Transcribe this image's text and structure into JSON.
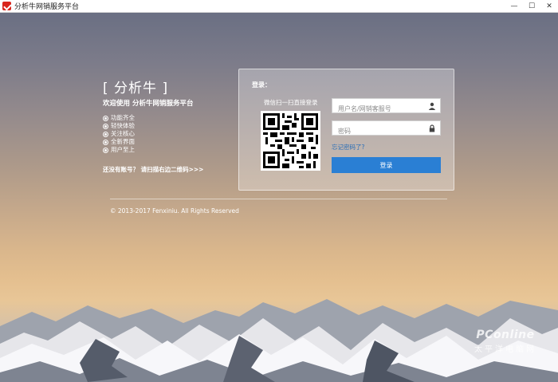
{
  "window": {
    "title": "分析牛网销服务平台",
    "minimize": "—",
    "maximize": "☐",
    "close": "✕"
  },
  "intro": {
    "brand": "[ 分析牛 ]",
    "welcome": "欢迎使用 分析牛网销服务平台",
    "features": [
      "功能齐全",
      "轻快体验",
      "关注核心",
      "全新界面",
      "用户至上"
    ],
    "register_prompt": "还没有账号？ 请扫描右边二维码>>>"
  },
  "login": {
    "label": "登录：",
    "qr_caption": "微信扫一扫直接登录",
    "username_placeholder": "用户名/网销客服号",
    "username_value": "",
    "password_placeholder": "密码",
    "password_value": "",
    "forgot_link": "忘记密码了?",
    "submit_label": "登录"
  },
  "footer": {
    "copyright": "© 2013-2017 Fenxiniu. All Rights Reserved"
  },
  "watermark": {
    "line1": "PConline",
    "line2": "太平洋电脑网"
  },
  "colors": {
    "accent": "#2a7fd4",
    "link": "#2b6fb8",
    "logo": "#d9261c"
  },
  "icons": {
    "app_logo": "app-logo-icon",
    "user": "user-icon",
    "lock": "lock-icon",
    "feature_bullet": "check-circle-icon"
  }
}
